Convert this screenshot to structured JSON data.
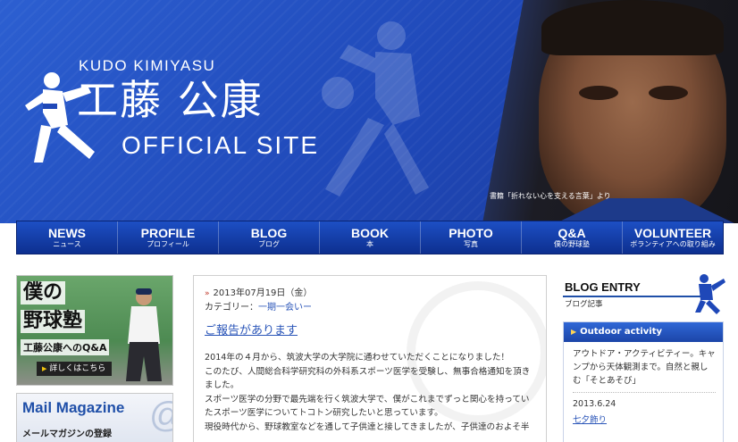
{
  "header": {
    "name_en": "KUDO KIMIYASU",
    "name_jp": "工藤 公康",
    "site_label": "OFFICIAL SITE",
    "photo_caption": "書籍「折れない心を支える言葉」より"
  },
  "nav": {
    "items": [
      {
        "en": "NEWS",
        "jp": "ニュース"
      },
      {
        "en": "PROFILE",
        "jp": "プロフィール"
      },
      {
        "en": "BLOG",
        "jp": "ブログ"
      },
      {
        "en": "BOOK",
        "jp": "本"
      },
      {
        "en": "PHOTO",
        "jp": "写真"
      },
      {
        "en": "Q&A",
        "jp": "僕の野球塾"
      },
      {
        "en": "VOLUNTEER",
        "jp": "ボランティアへの取り組み"
      }
    ]
  },
  "sidebar_left": {
    "juku_line1": "僕の",
    "juku_line2": "野球塾",
    "juku_line3": "工藤公康へのQ&A",
    "juku_button": "詳しくはこちら",
    "mail_title": "Mail Magazine",
    "mail_sub": "メールマガジンの登録",
    "mail_glyph": "@"
  },
  "post": {
    "date": "2013年07月19日（金）",
    "category_label": "カテゴリー：",
    "category_link": "一期一会いー",
    "title": "ご報告があります",
    "body": [
      "2014年の４月から、筑波大学の大学院に通わせていただくことになりました！",
      "このたび、人間総合科学研究科の外科系スポーツ医学を受験し、無事合格通知を頂きました。",
      "スポーツ医学の分野で最先端を行く筑波大学で、僕がこれまでずっと関心を持っていたスポーツ医学についてトコトン研究したいと思っています。",
      "現役時代から、野球教室などを通して子供達と接してきましたが、子供達のおよそ半"
    ]
  },
  "sidebar_right": {
    "title": "BLOG ENTRY",
    "subtitle": "ブログ記事",
    "section_title": "Outdoor activity",
    "entry1_text": "アウトドア・アクティビティー。キャンプから天体観測まで。自然と親しむ「そとあそび」",
    "entry2_date": "2013.6.24",
    "entry2_link": "七夕飾り"
  },
  "colors": {
    "brand_blue": "#1f48b8",
    "nav_blue": "#0d2f8f",
    "link_blue": "#2a55b8",
    "accent_red": "#c0392b"
  }
}
